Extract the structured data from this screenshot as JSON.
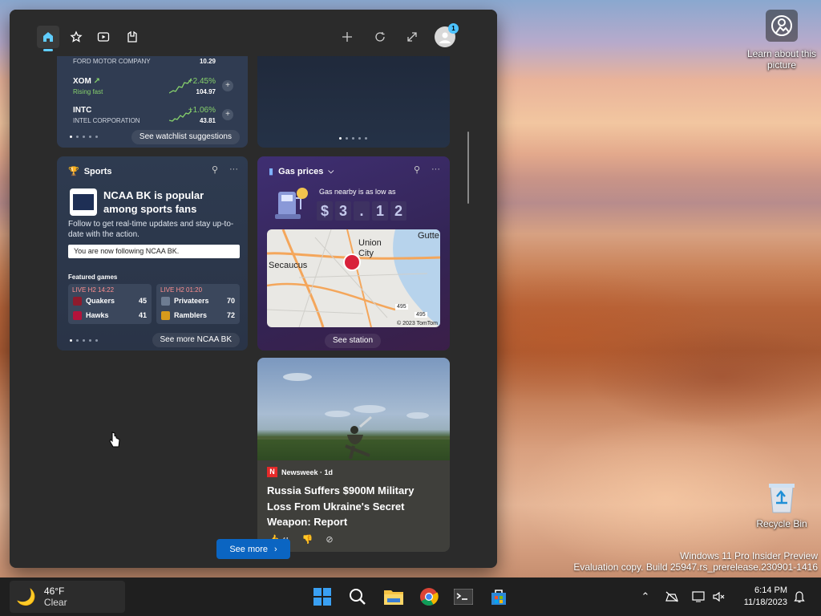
{
  "desktop": {
    "learn_label": "Learn about this picture",
    "recycle_label": "Recycle Bin",
    "watermark_line1": "Windows 11 Pro Insider Preview",
    "watermark_line2": "Evaluation copy. Build 25947.rs_prerelease.230901-1416"
  },
  "panel": {
    "nav": [
      "home-icon",
      "favorites-icon",
      "video-icon",
      "games-icon"
    ],
    "actions": [
      "add-icon",
      "refresh-icon",
      "expand-icon"
    ],
    "avatar_badge": "1"
  },
  "watchlist": {
    "stocks": [
      {
        "ticker": "",
        "name": "FORD MOTOR COMPANY",
        "change": "",
        "price": "10.29"
      },
      {
        "ticker": "XOM",
        "name": "Rising fast",
        "change": "+2.45%",
        "price": "104.97"
      },
      {
        "ticker": "INTC",
        "name": "INTEL CORPORATION",
        "change": "+1.06%",
        "price": "43.81"
      }
    ],
    "suggestions": "See watchlist suggestions"
  },
  "sports": {
    "title": "Sports",
    "headline": "NCAA BK is popular among sports fans",
    "body": "Follow to get real-time updates and stay up-to-date with the action.",
    "following": "You are now following NCAA BK.",
    "featured": "Featured games",
    "game1": {
      "status": "LIVE H2 14:22",
      "team1": "Quakers",
      "score1": "45",
      "team2": "Hawks",
      "score2": "41"
    },
    "game2": {
      "status": "LIVE H2 01:20",
      "team1": "Privateers",
      "score1": "70",
      "team2": "Ramblers",
      "score2": "72"
    },
    "see_more": "See more NCAA BK"
  },
  "gas": {
    "title": "Gas prices",
    "nearby": "Gas nearby is as low as",
    "price_digits": [
      "$",
      "3",
      ".",
      "1",
      "2"
    ],
    "map_labels": {
      "union_city": "Union City",
      "secaucus": "Secaucus",
      "gutt": "Gutte",
      "copyright": "© 2023 TomTom",
      "route1": "495",
      "route2": "495"
    },
    "see_station": "See station"
  },
  "news": {
    "source": "Newsweek · 1d",
    "headline": "Russia Suffers $900M Military Loss From Ukraine's Secret Weapon: Report",
    "likes": "41"
  },
  "see_more": "See more",
  "taskbar": {
    "temp": "46°F",
    "condition": "Clear",
    "time": "6:14 PM",
    "date": "11/18/2023"
  }
}
